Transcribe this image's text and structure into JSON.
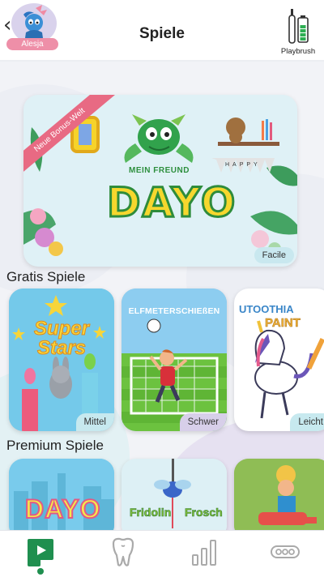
{
  "header": {
    "back_icon": "chevron-left-icon",
    "user_name": "Alesja",
    "title": "Spiele",
    "device_label": "Playbrush"
  },
  "hero": {
    "ribbon": "Neue Bonus-Welt",
    "logo_line1": "MEIN FREUND",
    "logo_line2": "DAYO",
    "banner": "HAPPY",
    "difficulty": "Facile"
  },
  "free_games": {
    "title": "Gratis Spiele",
    "cards": [
      {
        "logo_line1": "Super",
        "logo_line2": "Stars",
        "difficulty": "Mittel"
      },
      {
        "logo": "ELFMETERSCHIEßEN",
        "difficulty": "Schwer"
      },
      {
        "logo_line1": "UTOOTHIA",
        "logo_line2": "PAINT",
        "difficulty": "Leicht"
      }
    ]
  },
  "premium_games": {
    "title": "Premium Spiele",
    "cards": [
      {
        "logo": "DAYO"
      },
      {
        "logo_line1": "Fridolin",
        "logo_line2": "Frosch"
      },
      {
        "logo": ""
      }
    ]
  },
  "nav": {
    "items": [
      "play-logo-icon",
      "tooth-icon",
      "bar-chart-icon",
      "more-icon"
    ],
    "active": 0
  },
  "colors": {
    "accent": "#1f8f4f",
    "ribbon": "#e86a83",
    "pill": "#c7e9ef"
  }
}
